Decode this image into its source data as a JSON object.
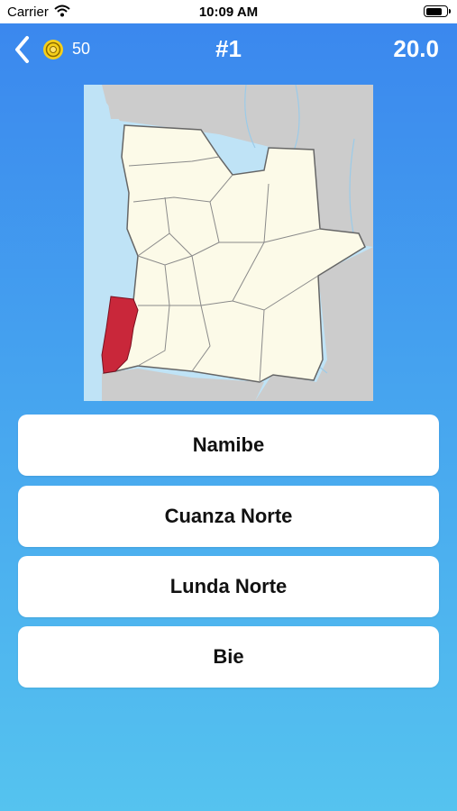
{
  "status_bar": {
    "carrier": "Carrier",
    "time": "10:09 AM",
    "battery_level": 0.85
  },
  "header": {
    "coins": "50",
    "question_number": "#1",
    "timer": "20.0"
  },
  "map": {
    "highlight_color": "#c9273a",
    "land_color": "#fcfae8",
    "sea_color": "#bfe3f6",
    "neighbor_color": "#cccccc"
  },
  "answers": [
    {
      "label": "Namibe"
    },
    {
      "label": "Cuanza Norte"
    },
    {
      "label": "Lunda Norte"
    },
    {
      "label": "Bie"
    }
  ]
}
